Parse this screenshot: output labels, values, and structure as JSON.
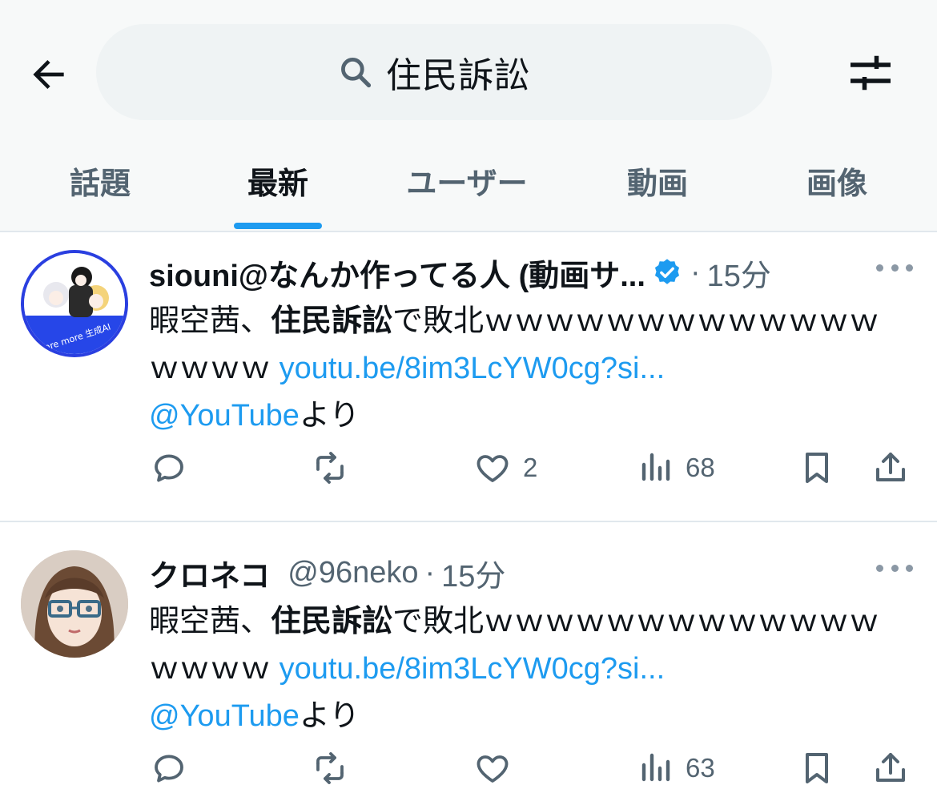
{
  "header": {
    "search_query": "住民訴訟",
    "back_icon": "arrow-left-icon",
    "filter_icon": "sliders-icon"
  },
  "tabs": [
    {
      "label": "話題",
      "active": false
    },
    {
      "label": "最新",
      "active": true
    },
    {
      "label": "ユーザー",
      "active": false
    },
    {
      "label": "動画",
      "active": false
    },
    {
      "label": "画像",
      "active": false
    }
  ],
  "colors": {
    "accent": "#1d9bf0",
    "text": "#0f1419",
    "muted": "#536471",
    "verified": "#1d9bf0"
  },
  "tweets": [
    {
      "name": "siouni@なんか作ってる人 (動画サ...",
      "handle": "",
      "verified": true,
      "sep": "·",
      "time": "15分",
      "avatar_caption": "more more 生成AI",
      "text_pre": "暇空茜、",
      "text_bold": "住民訴訟",
      "text_post": "で敗北ｗｗｗｗｗｗｗｗｗｗｗｗｗｗｗｗｗ ",
      "link": "youtu.be/8im3LcYW0cg?si...",
      "mention": "@YouTube",
      "mention_suffix": "より",
      "replies": "",
      "retweets": "",
      "likes": "2",
      "views": "68"
    },
    {
      "name": "クロネコ",
      "handle": "@96neko",
      "verified": false,
      "sep": "·",
      "time": "15分",
      "text_pre": "暇空茜、",
      "text_bold": "住民訴訟",
      "text_post": "で敗北ｗｗｗｗｗｗｗｗｗｗｗｗｗｗｗｗｗ ",
      "link": "youtu.be/8im3LcYW0cg?si...",
      "mention": "@YouTube",
      "mention_suffix": "より",
      "replies": "",
      "retweets": "",
      "likes": "",
      "views": "63"
    }
  ]
}
